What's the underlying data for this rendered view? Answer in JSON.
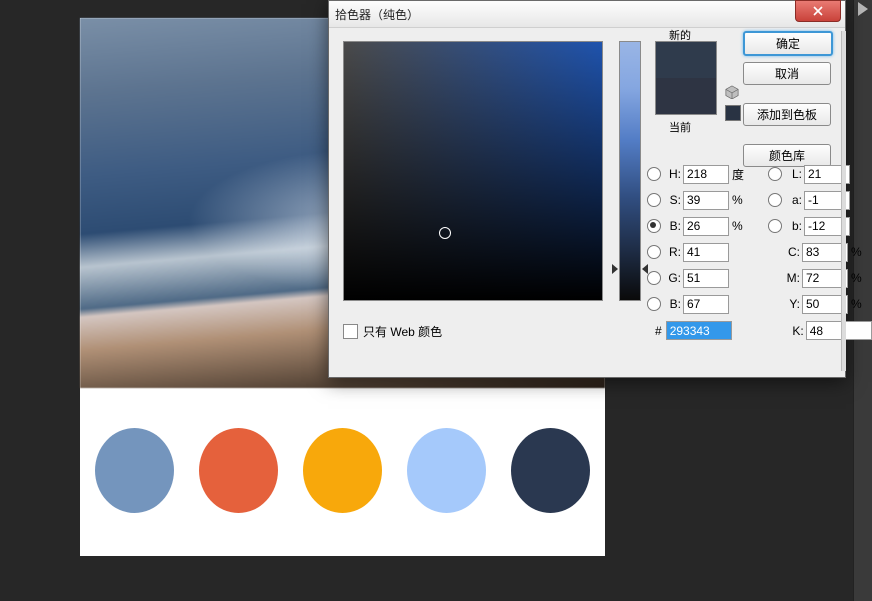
{
  "dialog": {
    "title": "拾色器（纯色）",
    "new_label": "新的",
    "current_label": "当前",
    "buttons": {
      "ok": "确定",
      "cancel": "取消",
      "add": "添加到色板",
      "lib": "颜色库"
    },
    "web_only": "只有 Web 颜色",
    "preview": {
      "new": "#2f3b4c",
      "current": "#2e3443"
    },
    "hsb": {
      "h": "218",
      "s": "39",
      "b": "26",
      "h_unit": "度",
      "pct": "%"
    },
    "lab": {
      "l": "21",
      "a": "-1",
      "b": "-12"
    },
    "rgb": {
      "r": "41",
      "g": "51",
      "b": "67"
    },
    "cmyk": {
      "c": "83",
      "m": "72",
      "y": "50",
      "k": "48"
    },
    "hex": "293343",
    "labels": {
      "H": "H:",
      "S": "S:",
      "B": "B:",
      "L": "L:",
      "a": "a:",
      "bb": "b:",
      "R": "R:",
      "G": "G:",
      "Bc": "B:",
      "C": "C:",
      "M": "M:",
      "Y": "Y:",
      "K": "K:",
      "hash": "#"
    }
  },
  "palette": [
    "#7495bd",
    "#e5613c",
    "#f8a80b",
    "#a5c9fb",
    "#2a3850"
  ]
}
